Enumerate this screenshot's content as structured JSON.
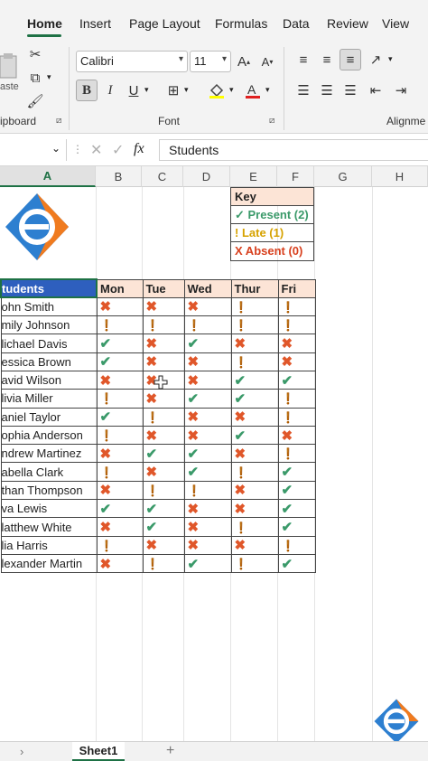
{
  "ribbon": {
    "tabs": [
      {
        "label": "Home",
        "active": true
      },
      {
        "label": "Insert"
      },
      {
        "label": "Page Layout"
      },
      {
        "label": "Formulas"
      },
      {
        "label": "Data"
      },
      {
        "label": "Review"
      },
      {
        "label": "View"
      }
    ],
    "clipboard_label": "ipboard",
    "paste_label": "aste",
    "font_group_label": "Font",
    "alignment_label": "Alignme",
    "font_name": "Calibri",
    "font_size": "11",
    "accent_color": "#1e7145"
  },
  "formula_bar": {
    "fx_label": "fx",
    "value": "Students"
  },
  "columns": [
    "A",
    "B",
    "C",
    "D",
    "E",
    "F",
    "G",
    "H"
  ],
  "key": {
    "title": "Key",
    "present": "✓ Present (2)",
    "late": "! Late (1)",
    "absent": "X Absent (0)",
    "colors": {
      "present": "#3b9a6a",
      "late": "#e6a817",
      "absent": "#e0572a",
      "header": "#fce4d6"
    }
  },
  "table": {
    "header": [
      "tudents",
      "Mon",
      "Tue",
      "Wed",
      "Thur",
      "Fri"
    ],
    "rows": [
      {
        "name": "ohn Smith",
        "marks": [
          "x",
          "x",
          "x",
          "!",
          "!"
        ]
      },
      {
        "name": "mily Johnson",
        "marks": [
          "!",
          "!",
          "!",
          "!",
          "!"
        ]
      },
      {
        "name": "lichael Davis",
        "marks": [
          "ok",
          "x",
          "ok",
          "x",
          "x"
        ]
      },
      {
        "name": "essica Brown",
        "marks": [
          "ok",
          "x",
          "x",
          "!",
          "x"
        ]
      },
      {
        "name": "avid Wilson",
        "marks": [
          "x",
          "x",
          "x",
          "ok",
          "ok"
        ]
      },
      {
        "name": "livia Miller",
        "marks": [
          "!",
          "x",
          "ok",
          "ok",
          "!"
        ]
      },
      {
        "name": "aniel Taylor",
        "marks": [
          "ok",
          "!",
          "x",
          "x",
          "!"
        ]
      },
      {
        "name": "ophia Anderson",
        "marks": [
          "!",
          "x",
          "x",
          "ok",
          "x"
        ]
      },
      {
        "name": "ndrew Martinez",
        "marks": [
          "x",
          "ok",
          "ok",
          "x",
          "!"
        ]
      },
      {
        "name": "abella Clark",
        "marks": [
          "!",
          "x",
          "ok",
          "!",
          "ok"
        ]
      },
      {
        "name": "than Thompson",
        "marks": [
          "x",
          "!",
          "!",
          "x",
          "ok"
        ]
      },
      {
        "name": "va Lewis",
        "marks": [
          "ok",
          "ok",
          "x",
          "x",
          "ok"
        ]
      },
      {
        "name": "latthew White",
        "marks": [
          "x",
          "ok",
          "x",
          "!",
          "ok"
        ]
      },
      {
        "name": "lia Harris",
        "marks": [
          "!",
          "x",
          "x",
          "x",
          "!"
        ]
      },
      {
        "name": "lexander Martin",
        "marks": [
          "x",
          "!",
          "ok",
          "!",
          "ok"
        ]
      }
    ]
  },
  "sheet_tab": "Sheet1",
  "add_sheet": "+"
}
